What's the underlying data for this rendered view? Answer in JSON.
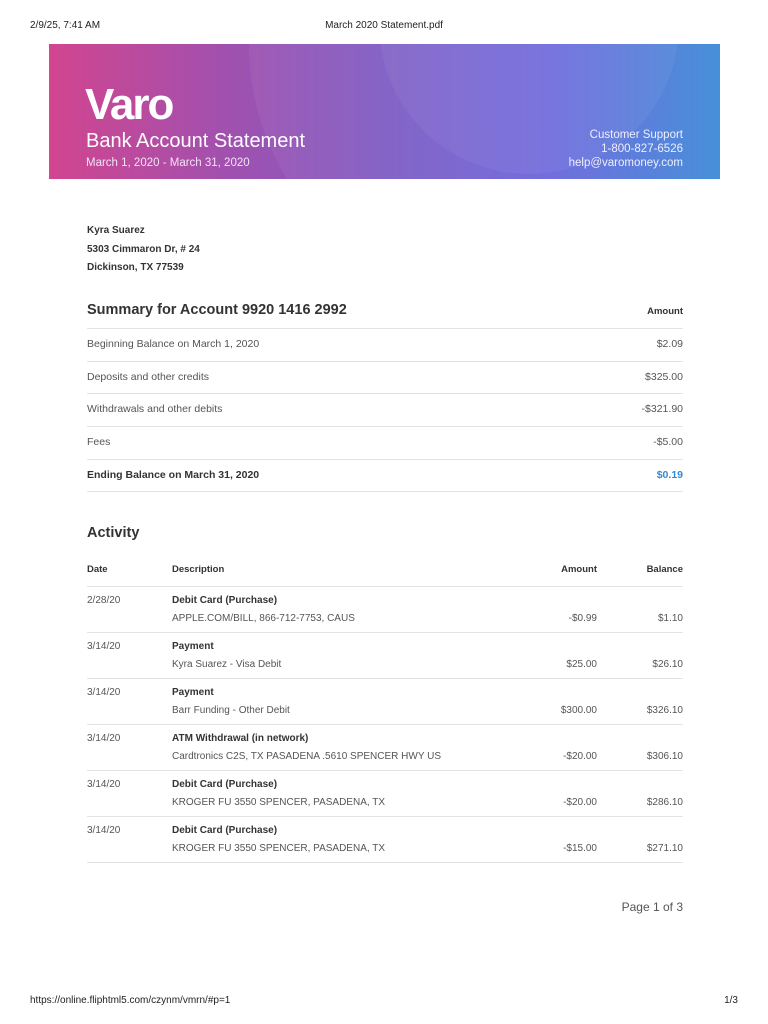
{
  "browser": {
    "datetime": "2/9/25, 7:41 AM",
    "doc_title": "March 2020 Statement.pdf",
    "url": "https://online.fliphtml5.com/czynm/vmrn/#p=1",
    "page_count": "1/3"
  },
  "header": {
    "logo": "Varo",
    "title": "Bank Account Statement",
    "period": "March 1, 2020 - March 31, 2020",
    "support_label": "Customer Support",
    "phone": "1-800-827-6526",
    "email": "help@varomoney.com"
  },
  "customer": {
    "name": "Kyra Suarez",
    "street": "5303 Cimmaron Dr, # 24",
    "city": "Dickinson, TX 77539"
  },
  "summary": {
    "title": "Summary for Account 9920 1416 2992",
    "amount_header": "Amount",
    "rows": [
      {
        "label": "Beginning Balance on March 1, 2020",
        "value": "$2.09"
      },
      {
        "label": "Deposits and other credits",
        "value": "$325.00"
      },
      {
        "label": "Withdrawals and other debits",
        "value": "-$321.90"
      },
      {
        "label": "Fees",
        "value": "-$5.00"
      }
    ],
    "ending": {
      "label": "Ending Balance on March 31, 2020",
      "value": "$0.19"
    }
  },
  "activity": {
    "title": "Activity",
    "headers": {
      "date": "Date",
      "description": "Description",
      "amount": "Amount",
      "balance": "Balance"
    },
    "rows": [
      {
        "date": "2/28/20",
        "type": "Debit Card (Purchase)",
        "detail": "APPLE.COM/BILL, 866-712-7753, CAUS",
        "amount": "-$0.99",
        "balance": "$1.10"
      },
      {
        "date": "3/14/20",
        "type": "Payment",
        "detail": "Kyra Suarez - Visa Debit",
        "amount": "$25.00",
        "balance": "$26.10"
      },
      {
        "date": "3/14/20",
        "type": "Payment",
        "detail": "Barr Funding - Other Debit",
        "amount": "$300.00",
        "balance": "$326.10"
      },
      {
        "date": "3/14/20",
        "type": "ATM Withdrawal (in network)",
        "detail": "Cardtronics C2S, TX PASADENA .5610 SPENCER HWY US",
        "amount": "-$20.00",
        "balance": "$306.10"
      },
      {
        "date": "3/14/20",
        "type": "Debit Card (Purchase)",
        "detail": "KROGER FU 3550 SPENCER, PASADENA, TX",
        "amount": "-$20.00",
        "balance": "$286.10"
      },
      {
        "date": "3/14/20",
        "type": "Debit Card (Purchase)",
        "detail": "KROGER FU 3550 SPENCER, PASADENA, TX",
        "amount": "-$15.00",
        "balance": "$271.10"
      }
    ]
  },
  "page_label": "Page 1 of 3"
}
